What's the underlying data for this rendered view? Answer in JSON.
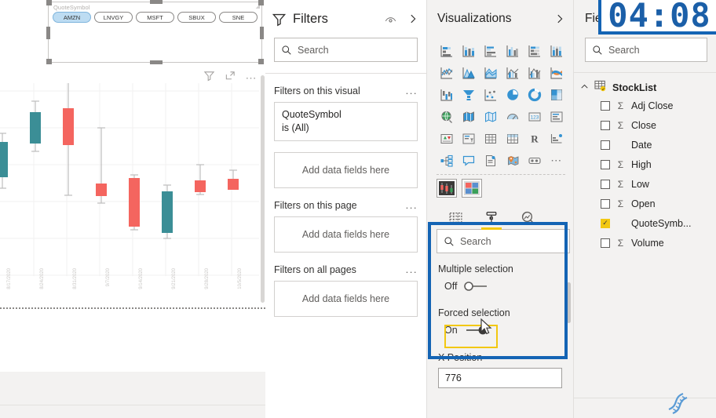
{
  "canvas": {
    "slicer": {
      "title": "QuoteSymbol",
      "items": [
        {
          "label": "AMZN",
          "selected": true
        },
        {
          "label": "LNVGY",
          "selected": false
        },
        {
          "label": "MSFT",
          "selected": false
        },
        {
          "label": "SBUX",
          "selected": false
        },
        {
          "label": "SNE",
          "selected": false
        }
      ]
    },
    "chart_header_icons": [
      "filter-icon",
      "focus-mode-icon",
      "more-options-icon"
    ]
  },
  "chart_data": {
    "type": "candlestick",
    "title": "",
    "xlabel": "",
    "ylabel": "",
    "up_color": "#3b8e96",
    "down_color": "#f4655f",
    "grid": true,
    "ylim": [
      2850,
      3600
    ],
    "categories": [
      "8/17/2020",
      "8/24/2020",
      "8/31/2020",
      "9/7/2020",
      "9/14/2020",
      "9/21/2020",
      "9/28/2020",
      "10/5/2020"
    ],
    "series": [
      {
        "name": "Open",
        "values": [
          3140,
          3220,
          3400,
          3050,
          3060,
          3020,
          3030,
          3040
        ]
      },
      {
        "name": "High",
        "values": [
          3215,
          3310,
          3545,
          3240,
          3080,
          3075,
          3105,
          3090
        ]
      },
      {
        "name": "Low",
        "values": [
          3060,
          3150,
          3000,
          2985,
          2900,
          2880,
          3020,
          3025
        ]
      },
      {
        "name": "Close",
        "values": [
          3205,
          3320,
          3265,
          3035,
          2935,
          2930,
          3025,
          3035
        ]
      }
    ],
    "direction": [
      "up",
      "up",
      "down",
      "down",
      "down",
      "up",
      "down",
      "down"
    ]
  },
  "filters": {
    "title": "Filters",
    "icons": [
      "filter-icon",
      "visibility-icon",
      "chevron-right-icon"
    ],
    "search_placeholder": "Search",
    "sections": [
      {
        "label": "Filters on this visual",
        "more": "...",
        "cards": [
          {
            "line1": "QuoteSymbol",
            "line2": "is (All)"
          }
        ],
        "drop_label": "Add data fields here"
      },
      {
        "label": "Filters on this page",
        "more": "...",
        "cards": [],
        "drop_label": "Add data fields here"
      },
      {
        "label": "Filters on all pages",
        "more": "...",
        "cards": [],
        "drop_label": "Add data fields here"
      }
    ]
  },
  "visualizations": {
    "title": "Visualizations",
    "collapse_icon": "chevron-right-icon",
    "icons": [
      "stacked-bar-chart-icon",
      "stacked-column-chart-icon",
      "clustered-bar-chart-icon",
      "clustered-column-chart-icon",
      "100-stacked-bar-chart-icon",
      "100-stacked-column-chart-icon",
      "line-chart-icon",
      "area-chart-icon",
      "stacked-area-chart-icon",
      "line-stacked-column-chart-icon",
      "line-clustered-column-chart-icon",
      "ribbon-chart-icon",
      "waterfall-chart-icon",
      "funnel-chart-icon",
      "scatter-chart-icon",
      "pie-chart-icon",
      "donut-chart-icon",
      "treemap-icon",
      "map-icon",
      "filled-map-icon",
      "shape-map-icon",
      "gauge-icon",
      "card-icon",
      "multi-row-card-icon",
      "kpi-icon",
      "slicer-icon",
      "table-icon",
      "matrix-icon",
      "r-script-visual-icon",
      "key-influencers-icon",
      "decomposition-tree-icon",
      "q-and-a-icon",
      "paginated-report-icon",
      "arcgis-map-icon",
      "power-apps-icon",
      "more-visuals-icon"
    ],
    "custom_icons": [
      "candlestick-custom-visual-icon",
      "grid-custom-visual-icon"
    ],
    "tabs": [
      {
        "name": "fields-tab",
        "icon": "fields-table-icon",
        "active": false
      },
      {
        "name": "format-tab",
        "icon": "paint-roller-icon",
        "active": true
      },
      {
        "name": "analytics-tab",
        "icon": "analytics-magnifier-icon",
        "active": false
      }
    ],
    "format_search_placeholder": "Search",
    "properties": [
      {
        "label": "Multiple selection",
        "type": "toggle",
        "value": "Off",
        "on": false
      },
      {
        "label": "Forced selection",
        "type": "toggle",
        "value": "On",
        "on": true,
        "focused": true
      },
      {
        "label": "X Position",
        "type": "text",
        "value": "776"
      }
    ]
  },
  "fields": {
    "title": "Fiel",
    "search_placeholder": "Search",
    "table": {
      "name": "StockList",
      "expand_icon": "chevron-up-icon",
      "table_icon": "table-key-icon"
    },
    "items": [
      {
        "label": "Adj Close",
        "aggregate": "Σ",
        "checked": false
      },
      {
        "label": "Close",
        "aggregate": "Σ",
        "checked": false
      },
      {
        "label": "Date",
        "aggregate": "",
        "checked": false
      },
      {
        "label": "High",
        "aggregate": "Σ",
        "checked": false
      },
      {
        "label": "Low",
        "aggregate": "Σ",
        "checked": false
      },
      {
        "label": "Open",
        "aggregate": "Σ",
        "checked": false
      },
      {
        "label": "QuoteSymb...",
        "aggregate": "",
        "checked": true
      },
      {
        "label": "Volume",
        "aggregate": "Σ",
        "checked": false
      }
    ]
  },
  "overlay": {
    "clock": "04:08",
    "clock_color": "#1b5fa8",
    "dna_icon": "dna-helix-icon"
  }
}
